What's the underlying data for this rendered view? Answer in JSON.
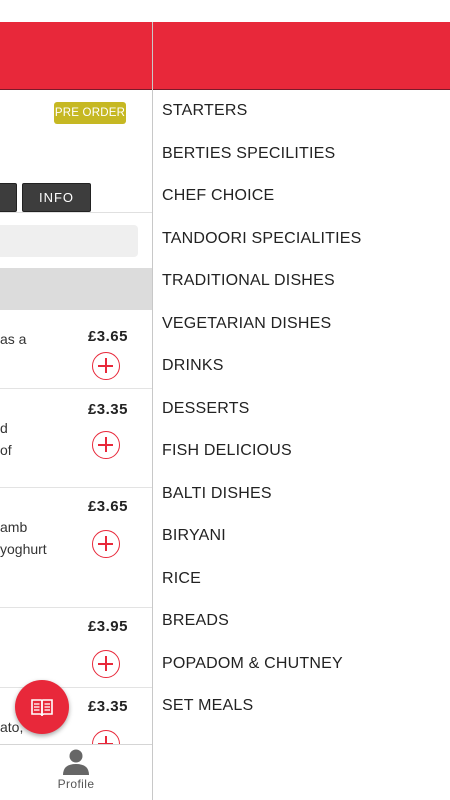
{
  "left_panel": {
    "pre_order_label": "PRE ORDER",
    "info_tab_label": "INFO",
    "items": [
      {
        "price": "£3.65",
        "desc": [
          "as a"
        ]
      },
      {
        "price": "£3.35",
        "desc": [
          "d",
          "of"
        ]
      },
      {
        "price": "£3.65",
        "desc": [
          "amb",
          "yoghurt"
        ]
      },
      {
        "price": "£3.95",
        "desc": []
      },
      {
        "price": "£3.35",
        "desc": [
          "ato,"
        ]
      }
    ],
    "bottom_nav": {
      "profile_label": "Profile"
    }
  },
  "drawer": {
    "categories": [
      "STARTERS",
      "BERTIES SPECILITIES",
      "CHEF CHOICE",
      "TANDOORI SPECIALITIES",
      "TRADITIONAL DISHES",
      "VEGETARIAN DISHES",
      "DRINKS",
      "DESSERTS",
      "FISH DELICIOUS",
      "BALTI DISHES",
      "BIRYANI",
      "RICE",
      "BREADS",
      "POPADOM & CHUTNEY",
      "SET MEALS"
    ]
  },
  "colors": {
    "brand_red": "#e8283a",
    "pre_order_badge": "#c6b823",
    "tab_button": "#3d3d3d"
  },
  "icons": {
    "fab": "menu-book-icon",
    "profile": "person-icon",
    "add": "add-circle-icon"
  }
}
